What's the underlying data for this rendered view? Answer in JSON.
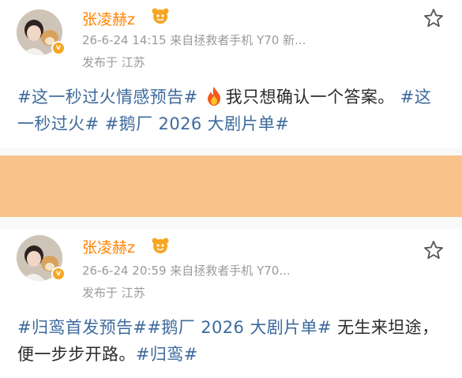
{
  "posts": [
    {
      "username": "张凌赫z",
      "meta": "26-6-24 14:15  来自拯救者手机 Y70 新...",
      "location": "发布于 江苏",
      "content": {
        "tag1": "#这一秒过火情感预告#",
        "text1": "我只想确认一个答案。",
        "tag2": "#这一秒过火#",
        "tag3": "#鹅厂 2026 大剧片单#"
      }
    },
    {
      "username": "张凌赫z",
      "meta": "26-6-24 20:59  来自拯救者手机 Y70...",
      "location": "发布于 江苏",
      "content": {
        "tag1": "#归鸾首发预告#",
        "tag2": "#鹅厂 2026 大剧片单#",
        "text1": "无生来坦途，便一步步开路。",
        "tag3": "#归鸾#"
      }
    }
  ],
  "colors": {
    "username": "#ff8200",
    "tag": "#3d6a9d",
    "banner": "#f8c48b",
    "meta": "#9a9a9a"
  },
  "icons": [
    "avatar",
    "verified-badge",
    "vip-fan-icon",
    "star-icon",
    "fire-icon"
  ]
}
